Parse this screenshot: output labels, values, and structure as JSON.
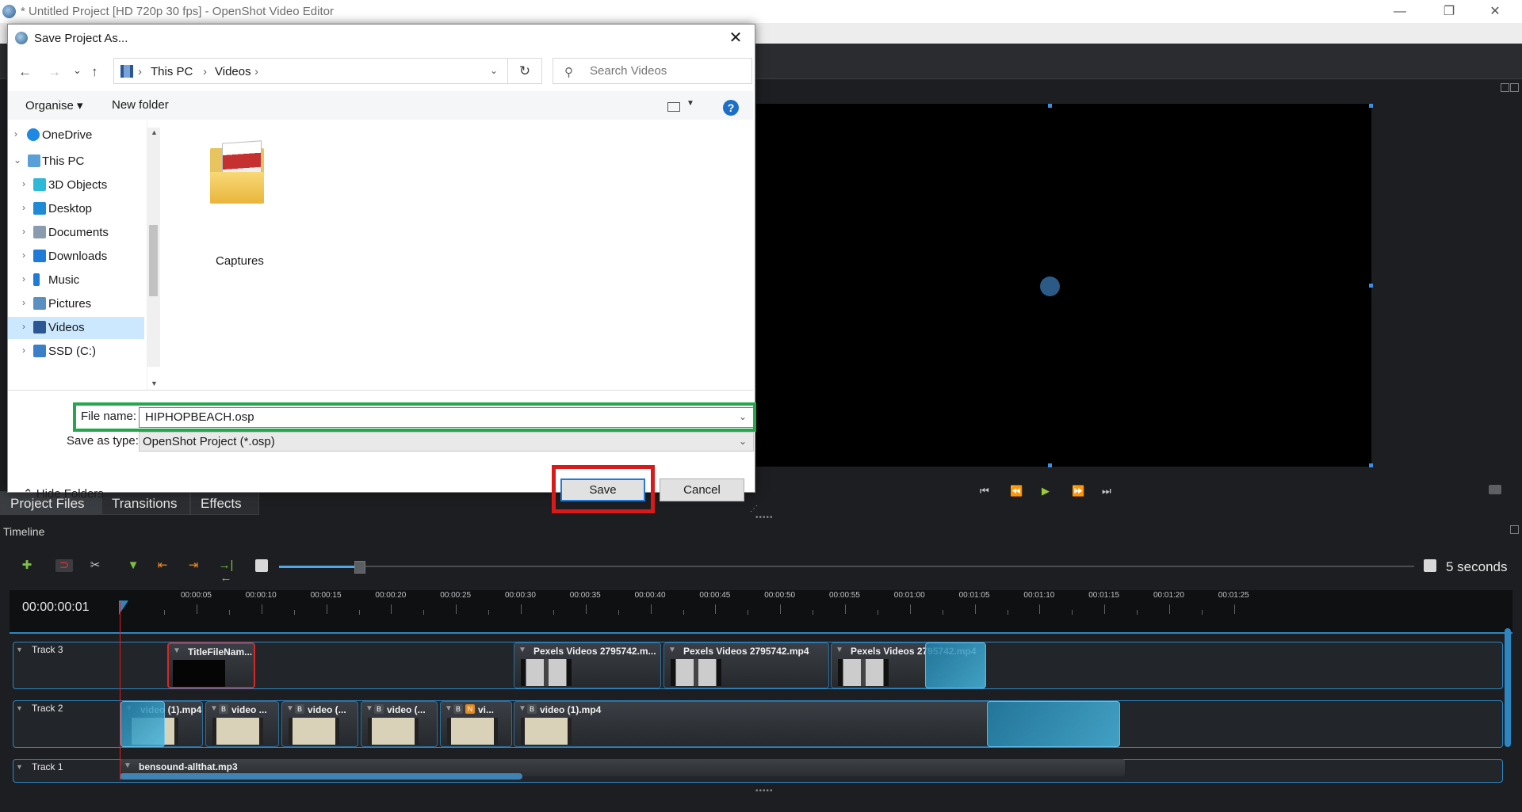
{
  "window": {
    "title": "* Untitled Project [HD 720p 30 fps] - OpenShot Video Editor",
    "minimize": "—",
    "maximize": "❐",
    "close": "✕"
  },
  "preview": {
    "controls": {
      "jump_start": "⏮",
      "rewind": "⏪",
      "play": "▶",
      "fast_forward": "⏩",
      "jump_end": "⏭"
    }
  },
  "tabs": [
    {
      "label": "Project Files"
    },
    {
      "label": "Transitions"
    },
    {
      "label": "Effects"
    }
  ],
  "timeline": {
    "label": "Timeline",
    "timecode": "00:00:00:01",
    "zoom_label": "5 seconds",
    "zoom_fraction": 0.07,
    "ticks": [
      "00:00:00:05",
      "00:00:00:10",
      "00:00:00:15",
      "00:00:00:20",
      "00:00:00:25",
      "00:00:00:30",
      "00:00:00:35",
      "00:00:00:40",
      "00:00:00:45",
      "00:00:00:50",
      "00:00:00:55",
      "00:00:01:00",
      "00:00:01:05",
      "00:00:01:10",
      "00:00:01:15",
      "00:00:01:20",
      "00:00:01:25"
    ],
    "tick_labels": [
      "00:00:05",
      "00:00:10",
      "00:00:15",
      "00:00:20",
      "00:00:25",
      "00:00:30",
      "00:00:35",
      "00:00:40",
      "00:00:45",
      "00:00:50",
      "00:00:55",
      "00:01:00",
      "00:01:05",
      "00:01:10",
      "00:01:15",
      "00:01:20",
      "00:01:25"
    ],
    "tracks": [
      {
        "name": "Track 3"
      },
      {
        "name": "Track 2"
      },
      {
        "name": "Track 1"
      }
    ],
    "track3_clips": [
      "TitleFileNam...",
      "Pexels Videos 2795742.m...",
      "Pexels Videos 2795742.mp4",
      "Pexels Videos 2795742.mp4"
    ],
    "track2_clips": [
      "video (1).mp4",
      "video ...",
      "video (...",
      "video (...",
      "vi...",
      "video (1).mp4"
    ],
    "track1_clip": "bensound-allthat.mp3",
    "badges": {
      "b": "B",
      "n": "N"
    }
  },
  "dialog": {
    "title": "Save Project As...",
    "close": "✕",
    "nav": {
      "back": "←",
      "forward": "→",
      "recent": "⌄",
      "up": "↑"
    },
    "breadcrumb": [
      "This PC",
      "Videos"
    ],
    "separator": "›",
    "refresh": "↻",
    "search_placeholder": "Search Videos",
    "organise": "Organise ▾",
    "new_folder": "New folder",
    "help": "?",
    "nav_pane": [
      {
        "label": "OneDrive",
        "icon": "cloud-icon",
        "color": "#1e88e5"
      },
      {
        "label": "This PC",
        "icon": "computer-icon",
        "color": "#5aa0d8"
      },
      {
        "label": "3D Objects",
        "icon": "cube-icon",
        "color": "#2fb9d8"
      },
      {
        "label": "Desktop",
        "icon": "desktop-icon",
        "color": "#1f8ad6"
      },
      {
        "label": "Documents",
        "icon": "documents-icon",
        "color": "#8a9bb0"
      },
      {
        "label": "Downloads",
        "icon": "download-icon",
        "color": "#1f7ad8"
      },
      {
        "label": "Music",
        "icon": "music-icon",
        "color": "#1f7ad8"
      },
      {
        "label": "Pictures",
        "icon": "pictures-icon",
        "color": "#5a8fbf"
      },
      {
        "label": "Videos",
        "icon": "videos-icon",
        "color": "#2b5797"
      },
      {
        "label": "SSD (C:)",
        "icon": "drive-icon",
        "color": "#3c7fc9"
      }
    ],
    "folders": [
      {
        "name": "Captures"
      }
    ],
    "file_name_label": "File name:",
    "file_name": "HIPHOPBEACH.osp",
    "save_type_label": "Save as type:",
    "save_type": "OpenShot Project (*.osp)",
    "hide_folders": "Hide Folders",
    "save": "Save",
    "cancel": "Cancel",
    "colors": {
      "highlight_filename": "#22a84a",
      "highlight_save": "#d91a1a",
      "selection": "#cce8ff"
    }
  }
}
